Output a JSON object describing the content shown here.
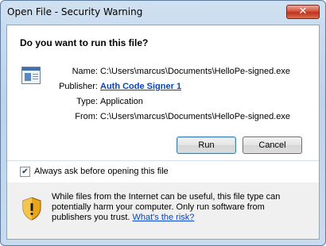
{
  "window": {
    "title": "Open File - Security Warning",
    "close_glyph": "✕"
  },
  "dialog": {
    "question": "Do you want to run this file?",
    "file_icon": "executable-file-icon",
    "fields": {
      "name_label": "Name:",
      "name_value": "C:\\Users\\marcus\\Documents\\HelloPe-signed.exe",
      "publisher_label": "Publisher:",
      "publisher_value": "Auth Code Signer 1",
      "type_label": "Type:",
      "type_value": "Application",
      "from_label": "From:",
      "from_value": "C:\\Users\\marcus\\Documents\\HelloPe-signed.exe"
    },
    "buttons": {
      "run": "Run",
      "cancel": "Cancel"
    },
    "checkbox": {
      "checked": true,
      "glyph": "✔",
      "label": "Always ask before opening this file"
    },
    "warning": {
      "icon": "security-shield-icon",
      "text": "While files from the Internet can be useful, this file type can potentially harm your computer. Only run software from publishers you trust.",
      "link": "What's the risk?"
    }
  },
  "colors": {
    "link": "#0645c8",
    "close_button": "#c0321c",
    "footer_bg": "#f0f0f0"
  }
}
